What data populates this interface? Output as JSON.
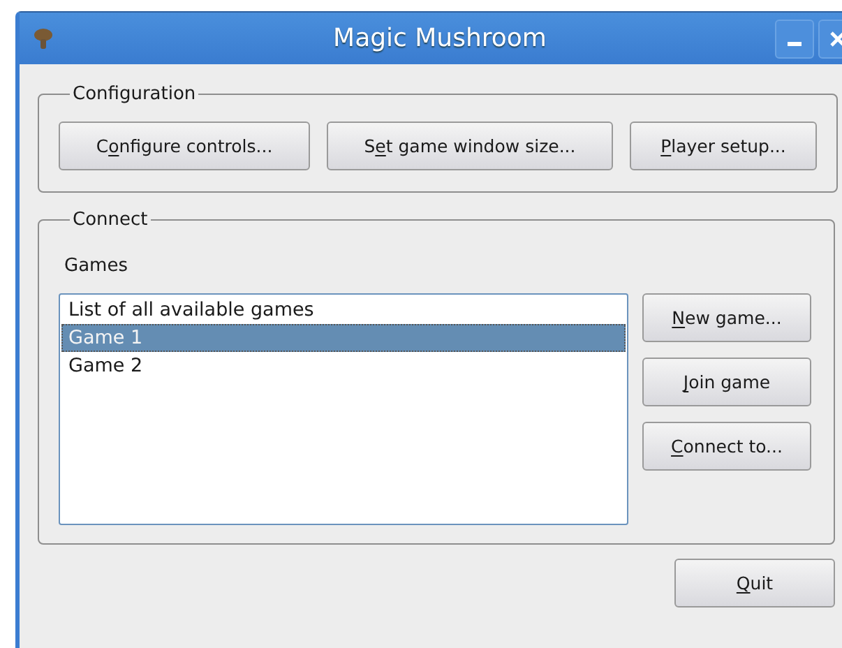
{
  "window": {
    "title": "Magic Mushroom"
  },
  "configuration": {
    "title": "Configuration",
    "buttons": [
      {
        "label": [
          {
            "text": "C",
            "underlined": false
          },
          {
            "text": "o",
            "underlined": true
          },
          {
            "text": "nfigure controls...",
            "underlined": false
          }
        ]
      },
      {
        "label": [
          {
            "text": "S",
            "underlined": false
          },
          {
            "text": "e",
            "underlined": true
          },
          {
            "text": "t game window size...",
            "underlined": false
          }
        ]
      },
      {
        "label": [
          {
            "text": "P",
            "underlined": true
          },
          {
            "text": "layer setup...",
            "underlined": false
          }
        ]
      }
    ]
  },
  "connect": {
    "title": "Connect",
    "games_label": "Games",
    "games": [
      {
        "label": "List of all available games",
        "selected": false
      },
      {
        "label": "Game 1",
        "selected": true
      },
      {
        "label": "Game 2",
        "selected": false
      }
    ],
    "buttons": [
      {
        "label": [
          {
            "text": "N",
            "underlined": true
          },
          {
            "text": "ew game...",
            "underlined": false
          }
        ]
      },
      {
        "label": [
          {
            "text": "J",
            "underlined": true
          },
          {
            "text": "oin game",
            "underlined": false
          }
        ]
      },
      {
        "label": [
          {
            "text": "C",
            "underlined": true
          },
          {
            "text": "onnect to...",
            "underlined": false
          }
        ]
      }
    ]
  },
  "quit": {
    "label": [
      {
        "text": "Q",
        "underlined": true
      },
      {
        "text": "uit",
        "underlined": false
      }
    ]
  }
}
